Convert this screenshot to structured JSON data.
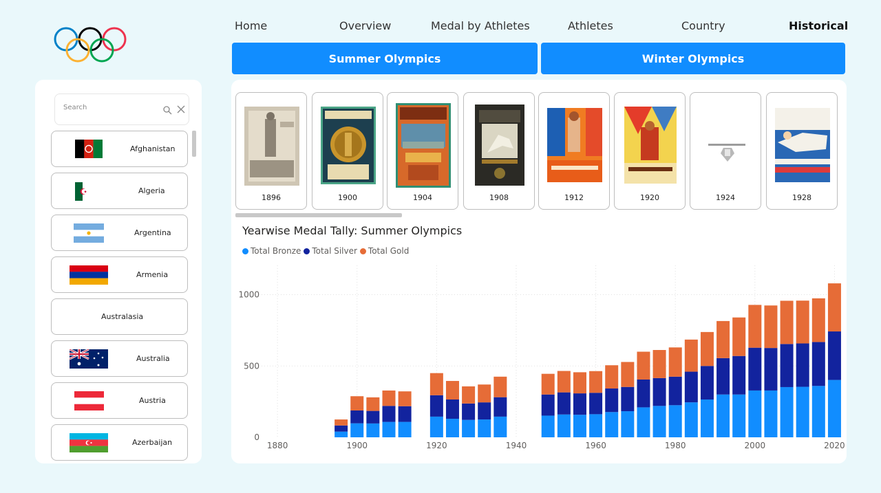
{
  "nav": {
    "items": [
      "Home",
      "Overview",
      "Medal by Athletes",
      "Athletes",
      "Country",
      "Historical"
    ],
    "active": "Historical"
  },
  "season_buttons": {
    "summer": "Summer Olympics",
    "winter": "Winter Olympics"
  },
  "filter": {
    "search_placeholder": "Search",
    "countries": [
      "Afghanistan",
      "Algeria",
      "Argentina",
      "Armenia",
      "Australasia",
      "Australia",
      "Austria",
      "Azerbaijan"
    ]
  },
  "posters": {
    "years": [
      "1896",
      "1900",
      "1904",
      "1908",
      "1912",
      "1920",
      "1924",
      "1928"
    ]
  },
  "colors": {
    "accent": "#118dff",
    "bronze": "#118dff",
    "silver": "#12239e",
    "gold": "#e66c37"
  },
  "chart_data": {
    "type": "bar",
    "stacked": true,
    "title": "Yearwise Medal Tally: Summer Olympics",
    "xlabel": "",
    "ylabel": "",
    "xlim": [
      1876,
      2022
    ],
    "ylim": [
      0,
      1100
    ],
    "xticks": [
      1880,
      1900,
      1920,
      1940,
      1960,
      1980,
      2000,
      2020
    ],
    "yticks": [
      0,
      500,
      1000
    ],
    "grid": true,
    "legend_position": "top-left",
    "x": [
      1896,
      1900,
      1904,
      1908,
      1912,
      1920,
      1924,
      1928,
      1932,
      1936,
      1948,
      1952,
      1956,
      1960,
      1964,
      1968,
      1972,
      1976,
      1980,
      1984,
      1988,
      1992,
      1996,
      2000,
      2004,
      2008,
      2012,
      2016,
      2020
    ],
    "series": [
      {
        "name": "Total Bronze",
        "values": [
          40,
          98,
          97,
          108,
          108,
          145,
          130,
          122,
          125,
          145,
          152,
          160,
          158,
          162,
          177,
          183,
          210,
          220,
          225,
          245,
          265,
          300,
          300,
          328,
          328,
          352,
          354,
          360,
          402
        ]
      },
      {
        "name": "Total Silver",
        "values": [
          43,
          90,
          88,
          112,
          110,
          150,
          135,
          115,
          120,
          136,
          148,
          155,
          150,
          150,
          165,
          170,
          195,
          195,
          200,
          215,
          235,
          255,
          270,
          300,
          298,
          302,
          304,
          308,
          340
        ]
      },
      {
        "name": "Total Gold",
        "values": [
          42,
          100,
          95,
          108,
          104,
          155,
          130,
          120,
          125,
          144,
          145,
          150,
          148,
          152,
          163,
          175,
          195,
          197,
          205,
          225,
          238,
          260,
          270,
          300,
          298,
          303,
          300,
          306,
          337
        ]
      }
    ]
  }
}
